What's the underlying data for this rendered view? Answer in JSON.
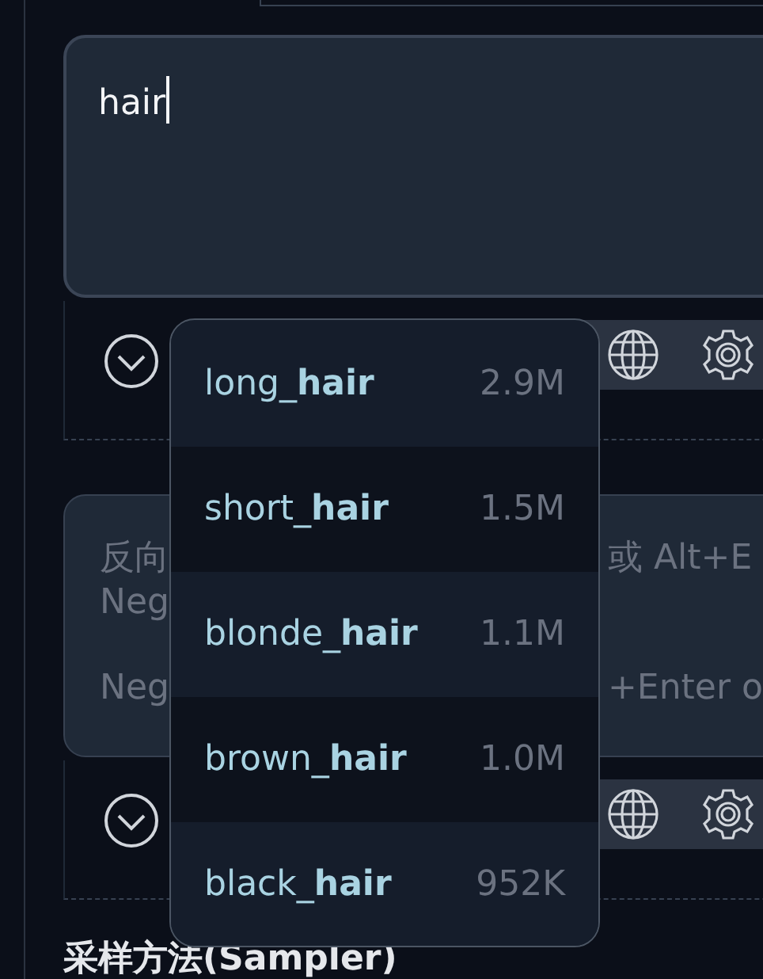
{
  "prompt": {
    "value": "hair"
  },
  "negative_prompt": {
    "placeholder_paragraphs": [
      [
        {
          "left": "反向",
          "right": "或 Alt+E"
        },
        {
          "left": "Neg"
        }
      ],
      [
        {
          "left": "Neg",
          "right": "+Enter o"
        }
      ]
    ]
  },
  "autocomplete": {
    "items": [
      {
        "tag": "long_**hair**",
        "count": "2.9M"
      },
      {
        "tag": "short_**hair**",
        "count": "1.5M"
      },
      {
        "tag": "blonde_**hair**",
        "count": "1.1M"
      },
      {
        "tag": "brown_**hair**",
        "count": "1.0M"
      },
      {
        "tag": "black_**hair**",
        "count": "952K"
      }
    ]
  },
  "section_label": "采样方法(Sampler)"
}
